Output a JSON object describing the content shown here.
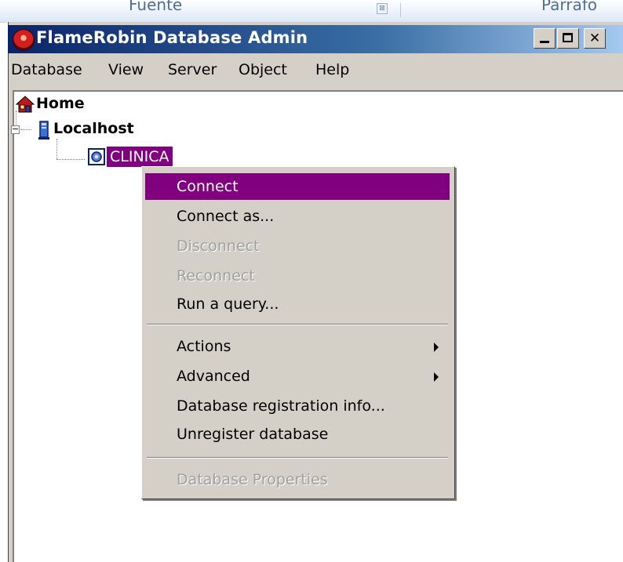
{
  "ribbon": {
    "left_label": "Fuente",
    "right_label": "Párrafo",
    "launcher": "⊠"
  },
  "window": {
    "title": "FlameRobin Database Admin",
    "minimize": "_",
    "maximize": "□",
    "close": "✕",
    "accent": "#800080",
    "title_gradient_start": "#0a246a"
  },
  "menubar": {
    "items": [
      "Database",
      "View",
      "Server",
      "Object",
      "Help"
    ]
  },
  "tree": {
    "home": "Home",
    "server": "Localhost",
    "expander": "−",
    "database": "CLINICA"
  },
  "context_menu": {
    "items": [
      {
        "label": "Connect",
        "state": "highlighted"
      },
      {
        "label": "Connect as...",
        "state": "enabled"
      },
      {
        "label": "Disconnect",
        "state": "disabled"
      },
      {
        "label": "Reconnect",
        "state": "disabled"
      },
      {
        "label": "Run a query...",
        "state": "enabled"
      },
      {
        "label": "Actions",
        "state": "enabled",
        "submenu": true
      },
      {
        "label": "Advanced",
        "state": "enabled",
        "submenu": true
      },
      {
        "label": "Database registration info...",
        "state": "enabled"
      },
      {
        "label": "Unregister database",
        "state": "enabled"
      },
      {
        "label": "Database Properties",
        "state": "disabled"
      }
    ]
  },
  "icons": {
    "home": "home-icon",
    "server": "server-icon",
    "database": "database-icon",
    "app": "flamerobin-icon",
    "submenu": "triangle-right-icon"
  }
}
